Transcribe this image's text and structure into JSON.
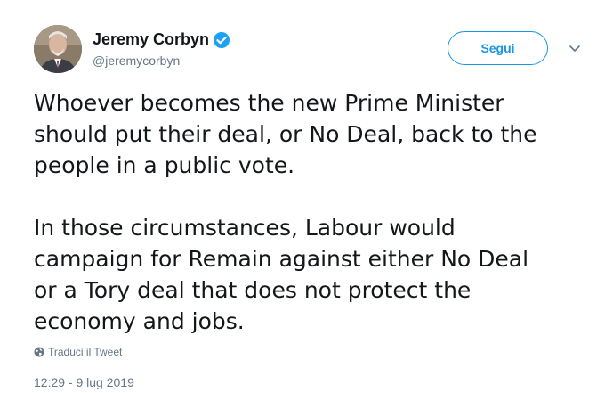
{
  "author": {
    "display_name": "Jeremy Corbyn",
    "handle": "@jeremycorbyn",
    "verified_icon": "verified-badge-icon"
  },
  "actions": {
    "follow_label": "Segui",
    "more_icon": "chevron-down-icon"
  },
  "tweet": {
    "paragraphs": [
      "Whoever becomes the new Prime Minister\nshould put their deal, or No Deal, back to the\npeople in a public vote.",
      "In those circumstances, Labour would\ncampaign for Remain against either No Deal\nor a Tory deal that does not protect the\neconomy and jobs."
    ],
    "translate_label": "Traduci il Tweet",
    "timestamp": "12:29 - 9 lug 2019"
  },
  "colors": {
    "accent": "#1b95e0",
    "text": "#14171a",
    "secondary": "#657786"
  }
}
